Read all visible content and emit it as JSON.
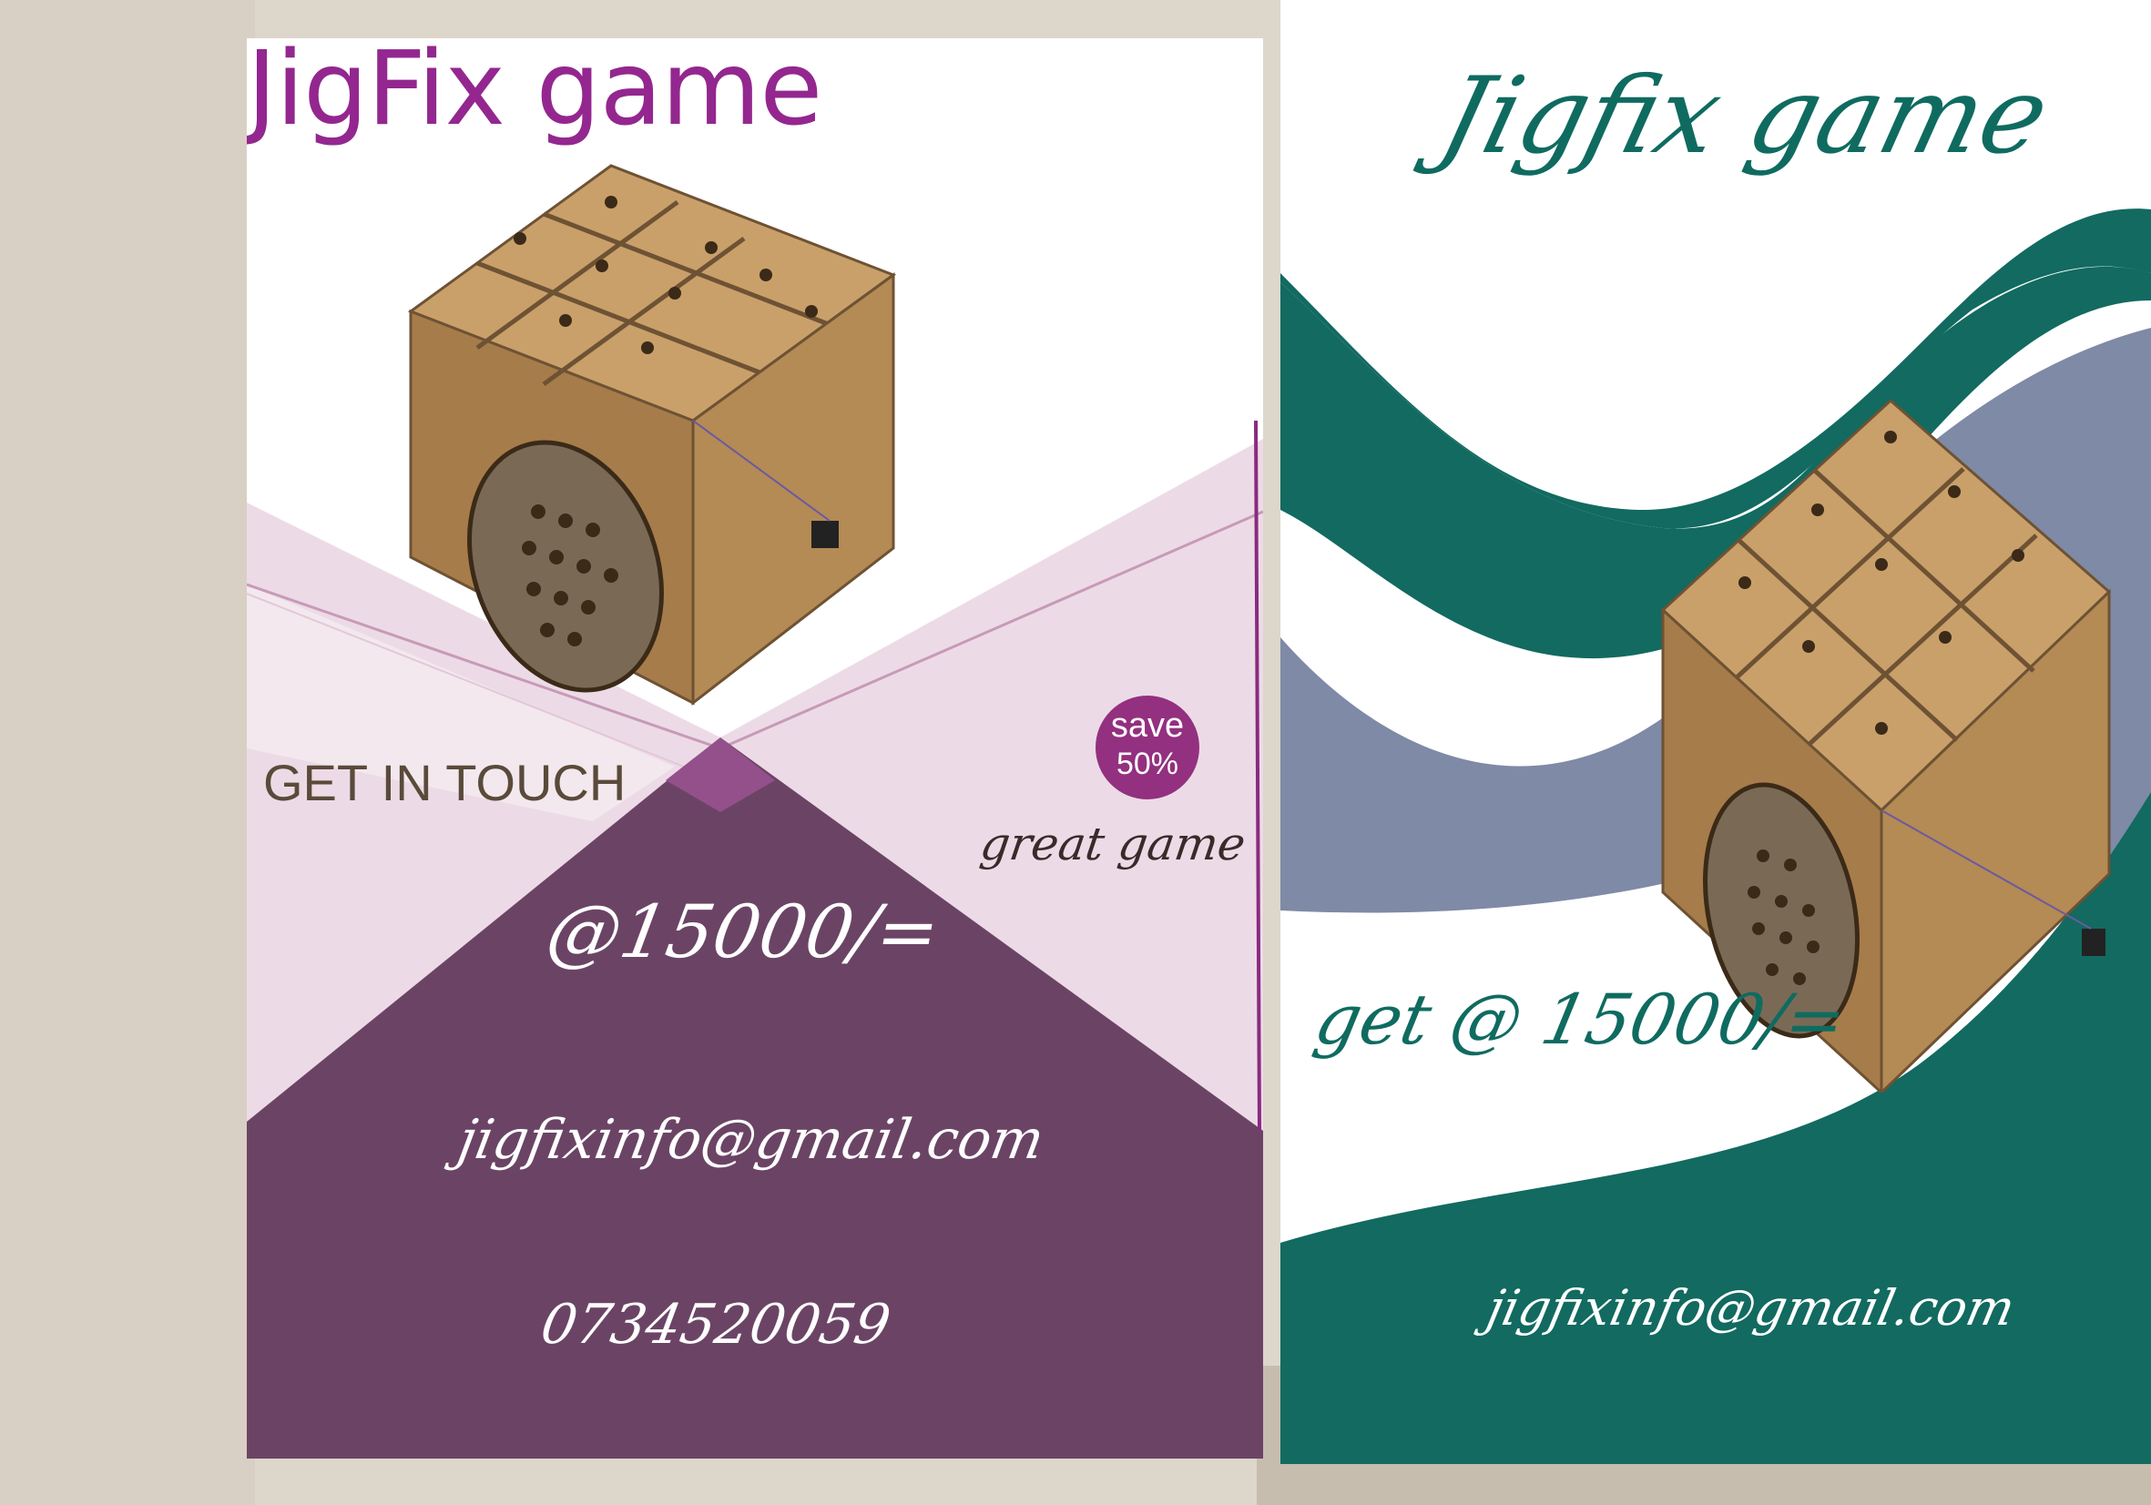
{
  "background": {
    "color": "#ddd6cb",
    "shadow_color": "#b8ac9c"
  },
  "left_flyer": {
    "title": "JigFix game",
    "call_to_action": "GET IN TOUCH",
    "badge": {
      "line1": "save",
      "line2": "50%"
    },
    "tagline": "great game",
    "price": "@15000/=",
    "email": "jigfixinfo@gmail.com",
    "phone": "0734520059",
    "colors": {
      "title": "#93278f",
      "panel": "#6b4465",
      "light_panel": "#ecdbe6",
      "badge": "#93307f"
    }
  },
  "right_flyer": {
    "title": "Jigfix game",
    "price": "get @ 15000/=",
    "email": "jigfixinfo@gmail.com",
    "colors": {
      "teal": "#126a60",
      "slate": "#7e8aa6",
      "title": "#0f6b60"
    }
  },
  "product_image": {
    "icon": "wooden-puzzle-box",
    "wood_color": "#b48a55",
    "grid": "3x3"
  }
}
